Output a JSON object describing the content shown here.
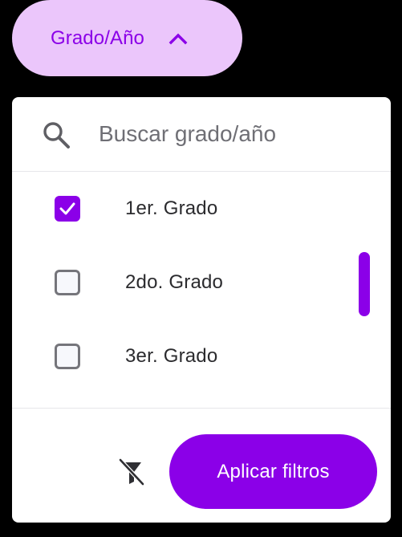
{
  "filter_chip": {
    "label": "Grado/Año",
    "icon": "chevron-up-icon",
    "expanded": true
  },
  "search": {
    "placeholder": "Buscar grado/año",
    "value": "",
    "icon": "search-icon"
  },
  "options": [
    {
      "label": "1er. Grado",
      "checked": true
    },
    {
      "label": "2do. Grado",
      "checked": false
    },
    {
      "label": "3er. Grado",
      "checked": false
    }
  ],
  "footer": {
    "clear_icon": "filter-off-icon",
    "apply_label": "Aplicar filtros"
  },
  "colors": {
    "accent": "#8b00e8",
    "chip_background": "#ebc6fb",
    "panel_background": "#ffffff",
    "page_background": "#000000"
  }
}
